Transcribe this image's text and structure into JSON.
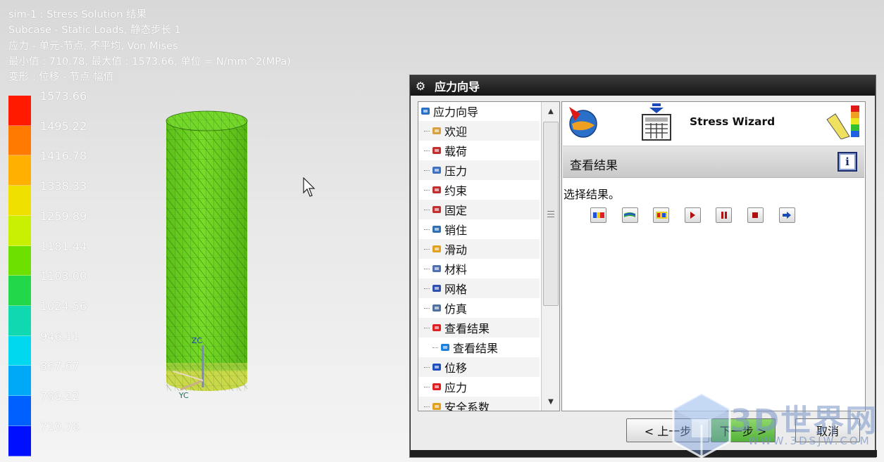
{
  "viewport": {
    "info_lines": [
      "sim-1 : Stress Solution 结果",
      "Subcase - Static Loads, 静态步长 1",
      "应力 - 单元-节点, 不平均, Von Mises",
      "最小值 : 710.78, 最大值 : 1573.66, 单位 = N/mm^2(MPa)",
      "变形 : 位移 - 节点 幅值"
    ],
    "legend": {
      "labels": [
        "1573.66",
        "1495.22",
        "1416.78",
        "1338.33",
        "1259.89",
        "1181.44",
        "1103.00",
        "1024.56",
        "946.11",
        "867.67",
        "789.22",
        "710.78"
      ],
      "colors": [
        "#ff1a00",
        "#ff7a00",
        "#ffb000",
        "#f0e000",
        "#c8f000",
        "#6ee000",
        "#22d84a",
        "#10d8b0",
        "#00d8f0",
        "#00a8f8",
        "#0060ff",
        "#0010ff"
      ]
    },
    "model_colors": {
      "body": "#6ed21e",
      "top": "#74d82a",
      "bottom": "#cbd84a"
    },
    "triad": {
      "zc": "ZC",
      "yc": "YC"
    }
  },
  "dialog": {
    "title": "应力向导",
    "tree": {
      "items": [
        {
          "label": "应力向导",
          "icon": "wizard-icon",
          "level": 0
        },
        {
          "label": "欢迎",
          "icon": "welcome-icon",
          "level": 1
        },
        {
          "label": "载荷",
          "icon": "load-icon",
          "level": 1
        },
        {
          "label": "压力",
          "icon": "pressure-icon",
          "level": 1
        },
        {
          "label": "约束",
          "icon": "constraint-icon",
          "level": 1
        },
        {
          "label": "固定",
          "icon": "fixed-icon",
          "level": 1
        },
        {
          "label": "销住",
          "icon": "pin-icon",
          "level": 1
        },
        {
          "label": "滑动",
          "icon": "slide-icon",
          "level": 1
        },
        {
          "label": "材料",
          "icon": "material-icon",
          "level": 1
        },
        {
          "label": "网格",
          "icon": "mesh-icon",
          "level": 1
        },
        {
          "label": "仿真",
          "icon": "simulation-icon",
          "level": 1
        },
        {
          "label": "查看结果",
          "icon": "results-icon",
          "level": 1
        },
        {
          "label": "查看结果",
          "icon": "results-current-icon",
          "level": 2
        },
        {
          "label": "位移",
          "icon": "displacement-icon",
          "level": 1
        },
        {
          "label": "应力",
          "icon": "stress-icon",
          "level": 1
        },
        {
          "label": "安全系数",
          "icon": "safety-factor-icon",
          "level": 1
        }
      ]
    },
    "header": {
      "title": "Stress Wizard"
    },
    "section": {
      "title": "查看结果",
      "info_label": "i"
    },
    "prompt": "选择结果。",
    "toolbar_icons": [
      "contour-plot-icon",
      "deformed-plot-icon",
      "fringe-plot-icon",
      "play-icon",
      "pause-icon",
      "stop-icon",
      "next-icon"
    ],
    "buttons": {
      "back": "< 上一步",
      "next": "下一步 >",
      "cancel": "取消"
    }
  },
  "watermark": {
    "text": "3D世界网",
    "url": "WWW.3DSJW.COM"
  }
}
